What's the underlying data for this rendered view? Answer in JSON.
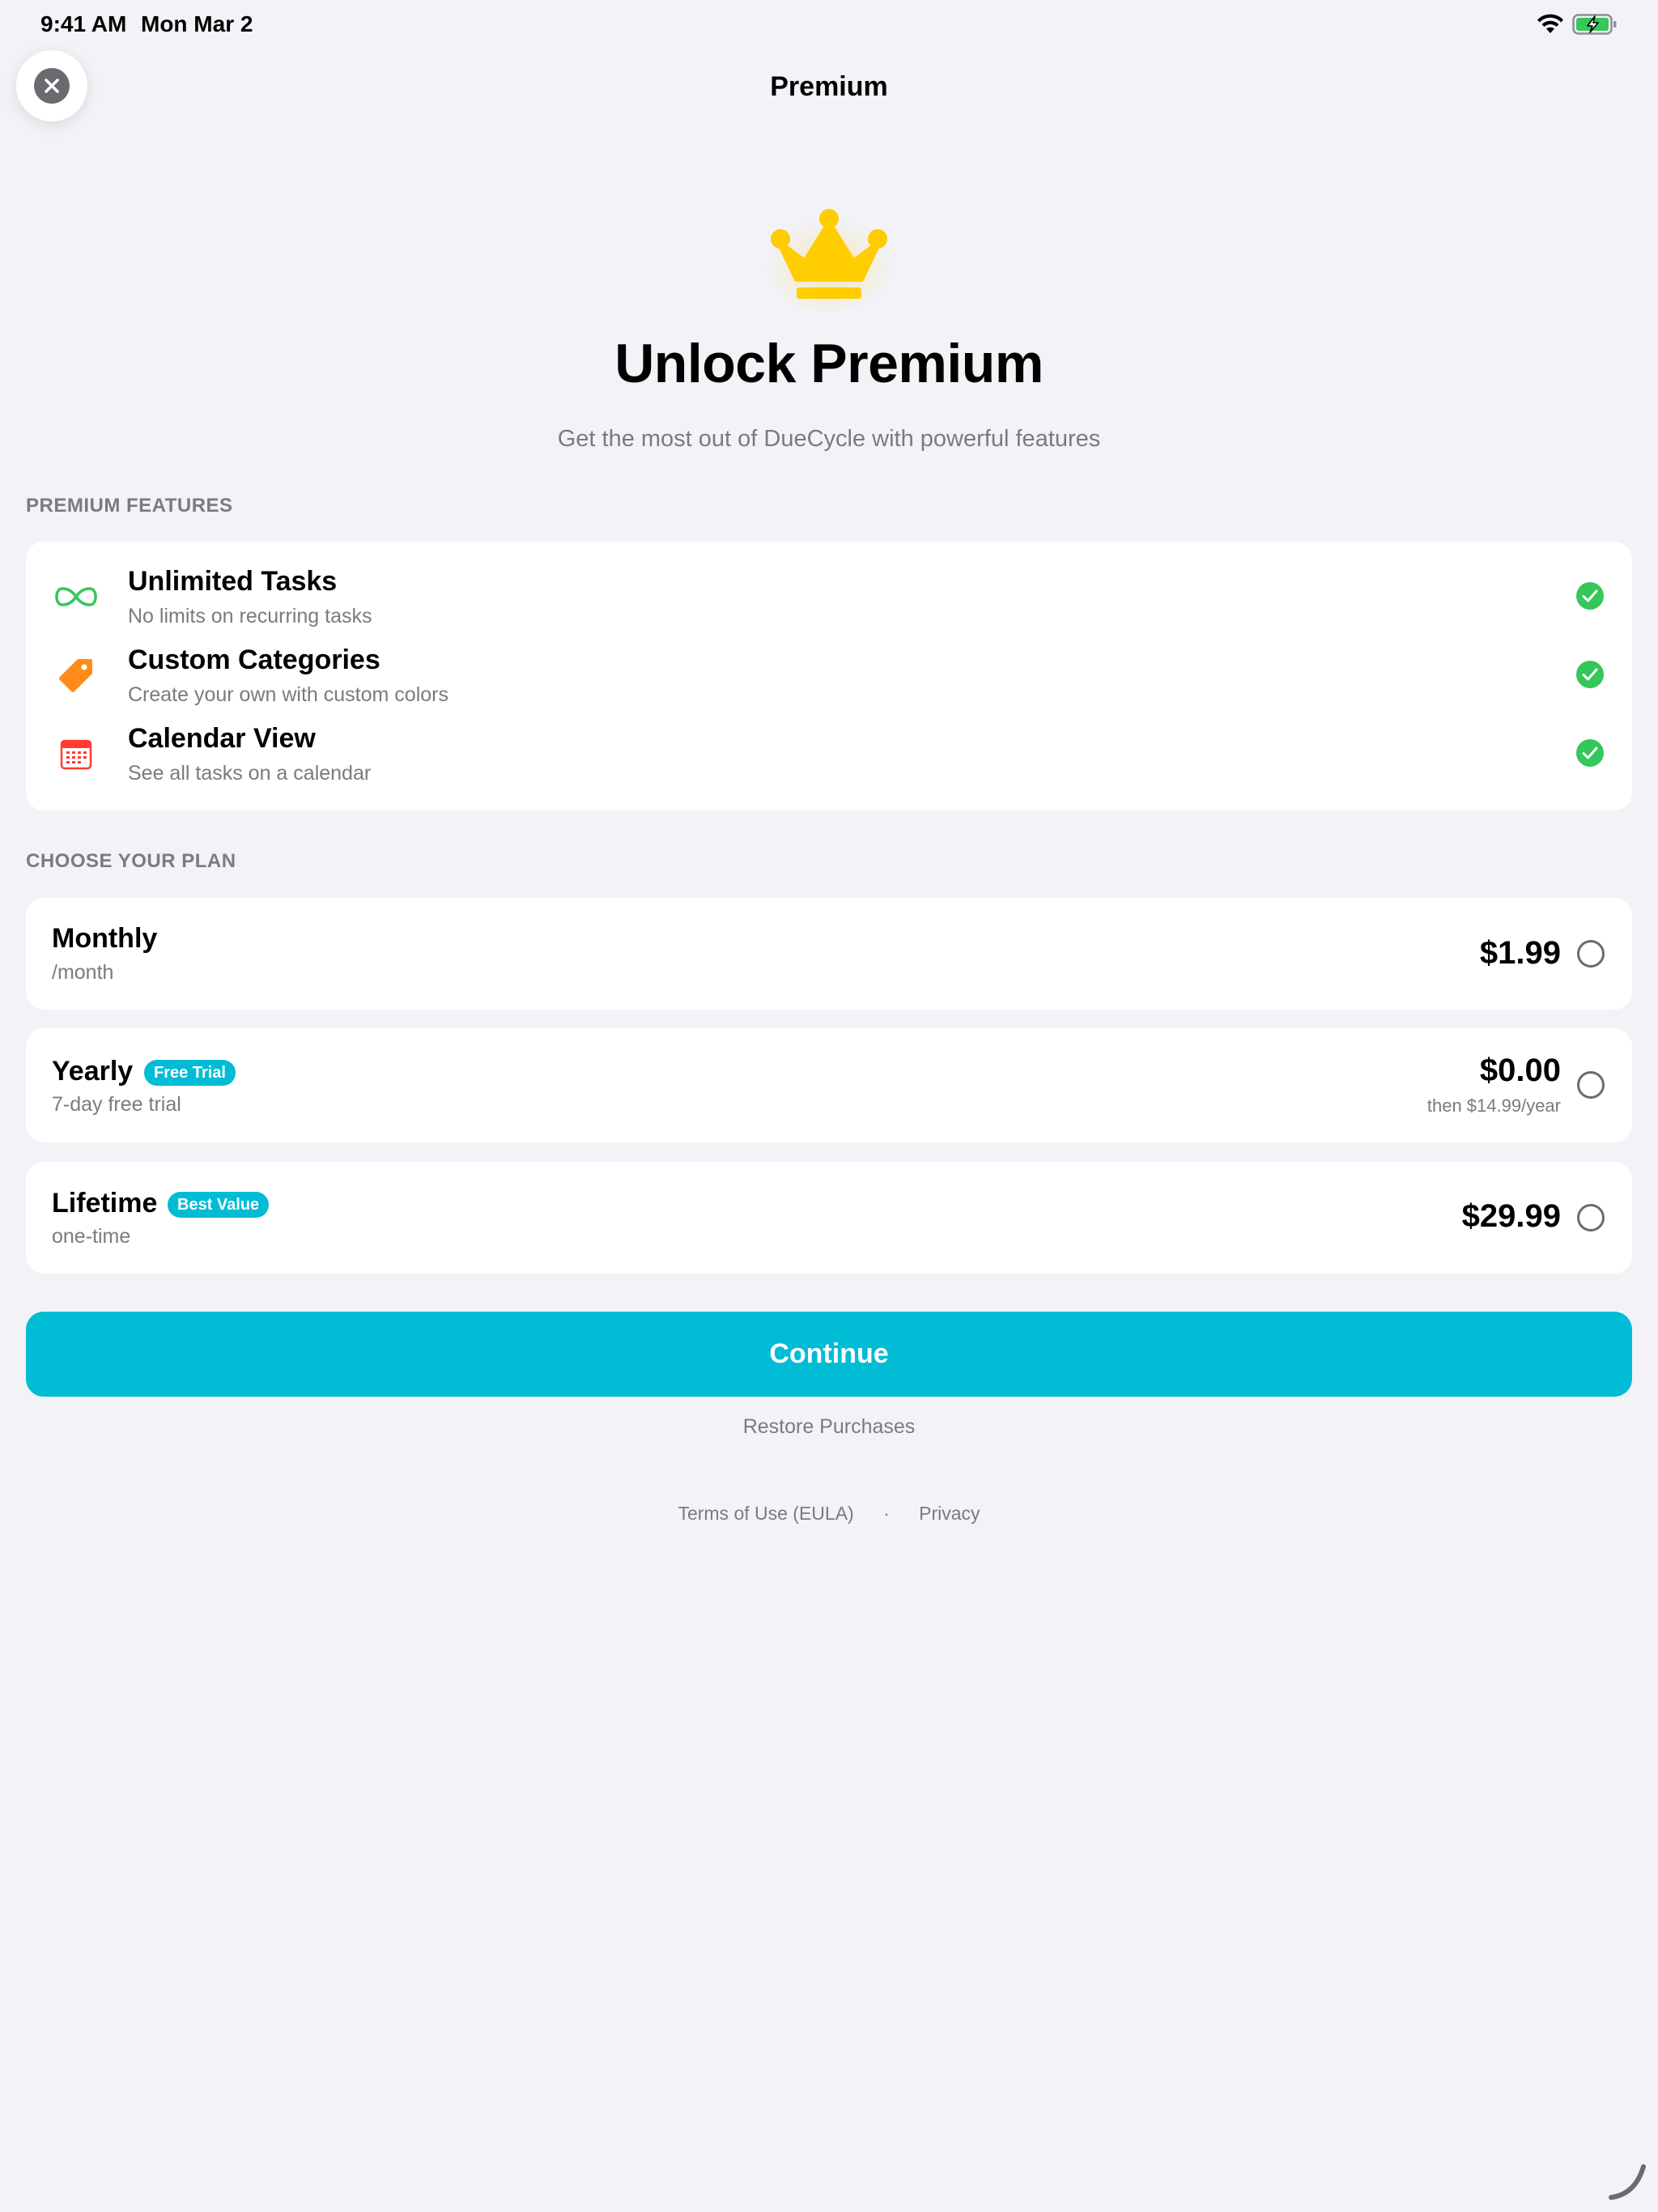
{
  "status_bar": {
    "time": "9:41 AM",
    "date": "Mon Mar 2"
  },
  "nav": {
    "title": "Premium",
    "close_icon": "close-icon"
  },
  "hero": {
    "icon": "crown-icon",
    "title": "Unlock Premium",
    "subtitle": "Get the most out of DueCycle with powerful features"
  },
  "features": {
    "header": "PREMIUM FEATURES",
    "items": [
      {
        "title": "Unlimited Tasks",
        "subtitle": "No limits on recurring tasks",
        "icon": "infinity-icon",
        "color": "#34c759"
      },
      {
        "title": "Custom Categories",
        "subtitle": "Create your own with custom colors",
        "icon": "tag-icon",
        "color": "#ff8c1a"
      },
      {
        "title": "Calendar View",
        "subtitle": "See all tasks on a calendar",
        "icon": "calendar-icon",
        "color": "#ff3b30"
      }
    ]
  },
  "plans": {
    "header": "CHOOSE YOUR PLAN",
    "items": [
      {
        "name": "Monthly",
        "subtitle": "/month",
        "price": "$1.99",
        "badge": "",
        "note": ""
      },
      {
        "name": "Yearly",
        "subtitle": "7-day free trial",
        "price": "$0.00",
        "badge": "Free Trial",
        "note": "then $14.99/year"
      },
      {
        "name": "Lifetime",
        "subtitle": "one-time",
        "price": "$29.99",
        "badge": "Best Value",
        "note": ""
      }
    ]
  },
  "actions": {
    "continue": "Continue",
    "restore": "Restore Purchases"
  },
  "footer": {
    "terms": "Terms of Use (EULA)",
    "separator": "·",
    "privacy": "Privacy"
  },
  "colors": {
    "accent": "#00bcd4",
    "check": "#34c759",
    "crown": "#ffcc00",
    "background": "#f2f2f7"
  }
}
